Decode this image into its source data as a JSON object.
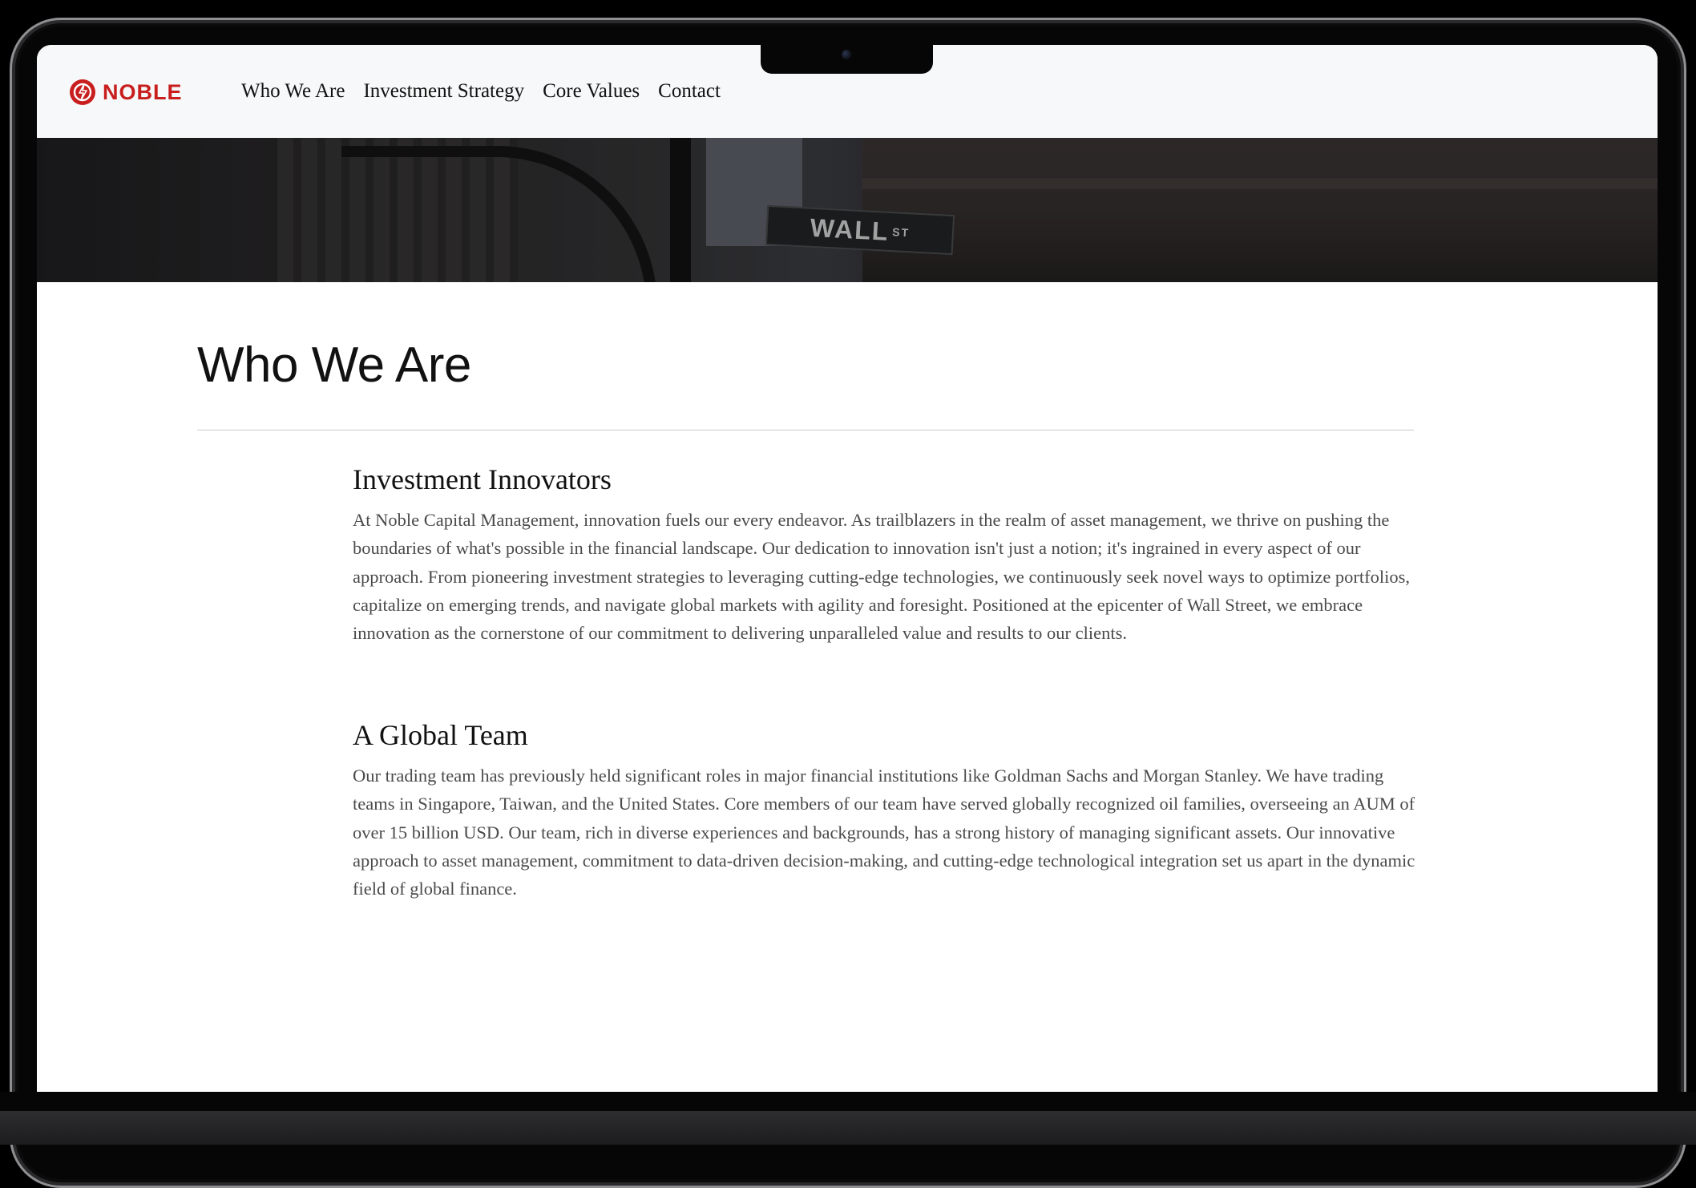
{
  "header": {
    "logo_text": "NOBLE",
    "nav": [
      "Who We Are",
      "Investment Strategy",
      "Core Values",
      "Contact"
    ]
  },
  "hero": {
    "sign_text": "WALL",
    "sign_suffix": "ST"
  },
  "page": {
    "title": "Who We Are",
    "sections": [
      {
        "heading": "Investment Innovators",
        "body": "At Noble Capital Management, innovation fuels our every endeavor. As trailblazers in the realm of asset management, we thrive on pushing the boundaries of what's possible in the financial landscape. Our dedication to innovation isn't just a notion; it's ingrained in every aspect of our approach. From pioneering investment strategies to leveraging cutting-edge technologies, we continuously seek novel ways to optimize portfolios, capitalize on emerging trends, and navigate global markets with agility and foresight. Positioned at the epicenter of Wall Street, we embrace innovation as the cornerstone of our commitment to delivering unparalleled value and results to our clients."
      },
      {
        "heading": "A Global Team",
        "body": "Our trading team has previously held significant roles in major financial institutions like Goldman Sachs and Morgan Stanley. We have trading teams in Singapore, Taiwan, and the United States. Core members of our team have served globally recognized oil families, overseeing an AUM of over 15 billion USD. Our team, rich in diverse experiences and backgrounds, has a strong history of managing significant assets. Our innovative approach to asset management, commitment to data-driven decision-making, and cutting-edge technological integration set us apart in the dynamic field of global finance."
      }
    ]
  },
  "colors": {
    "brand_red": "#c81e1e",
    "header_bg": "#f7f8f9",
    "body_text": "#4a4a4a"
  }
}
